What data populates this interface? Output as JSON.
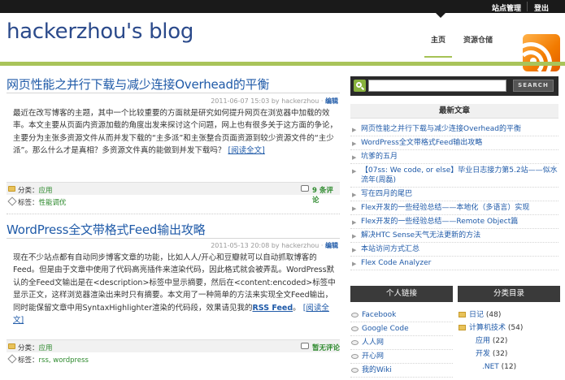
{
  "topbar": {
    "site_admin": "站点管理",
    "logout": "登出"
  },
  "header": {
    "blog_title": "hackerzhou's blog",
    "nav": [
      "主页",
      "资源仓储"
    ]
  },
  "posts": [
    {
      "title": "网页性能之并行下载与减少连接Overhead的平衡",
      "meta": "2011-06-07 15:03 by hackerzhou · ",
      "edit": "编辑",
      "body": "最近在改写博客的主题，其中一个比较重要的方面就是研究如何提升网页在浏览器中加载的效率。本文主要从页面内资源加载的角度出发来探讨这个问题，网上也有很多关于这方面的争论，主要分为主张多资源文件从而并发下载的“主多派”和主张整合页面资源到较少资源文件的“主少派”。那么什么才是真相？多资源文件真的能做到并发下载吗？",
      "more": "[阅读全文]",
      "category_label": "分类：",
      "category": "应用",
      "tags_label": "标签：",
      "tags": "性能调优",
      "comments": "9 条评论"
    },
    {
      "title": "WordPress全文带格式Feed输出攻略",
      "meta": "2011-05-13 20:08 by hackerzhou · ",
      "edit": "编辑",
      "body": "现在不少站点都有自动同步博客文章的功能，比如人人/开心和豆瓣就可以自动抓取博客的Feed。但是由于文章中使用了代码高亮插件来渲染代码，因此格式就会被弄乱。WordPress默认的全Feed文输出是在<description>标签中显示摘要，然后在<content:encoded>标签中显示正文，这样浏览器渲染出来时只有摘要。本文用了一种简单的方法来实现全文Feed输出，同时能保留文章中用SyntaxHighlighter渲染的代码段，效果请见我的",
      "feed_link": "RSS Feed",
      "body_tail": "。",
      "more": "[阅读全文]",
      "category_label": "分类：",
      "category": "应用",
      "tags_label": "标签：",
      "tags": "rss, wordpress",
      "comments": "暂无评论"
    }
  ],
  "sidebar": {
    "search_placeholder": "",
    "search_button": "SEARCH",
    "recent_title": "最新文章",
    "recent": [
      "网页性能之并行下载与减少连接Overhead的平衡",
      "WordPress全文带格式Feed输出攻略",
      "坑爹的五月",
      "【07ss: We code, or else】毕业日志接力第5.2站——似水流年(周磊)",
      "写在四月的尾巴",
      "Flex开发的一些经验总结——本地化（多语言）实现",
      "Flex开发的一些经验总结——Remote Object篇",
      "解决HTC Sense天气无法更新的方法",
      "本站访问方式汇总",
      "Flex Code Analyzer"
    ],
    "links_title": "个人链接",
    "links": [
      "Facebook",
      "Google Code",
      "人人网",
      "开心网",
      "我的Wiki"
    ],
    "categories_title": "分类目录",
    "categories": [
      {
        "name": "日记",
        "count": "(48)"
      },
      {
        "name": "计算机技术",
        "count": "(54)"
      },
      {
        "name": "应用",
        "count": "(22)"
      },
      {
        "name": "开发",
        "count": "(32)"
      },
      {
        "name": ".NET",
        "count": "(12)"
      }
    ]
  }
}
